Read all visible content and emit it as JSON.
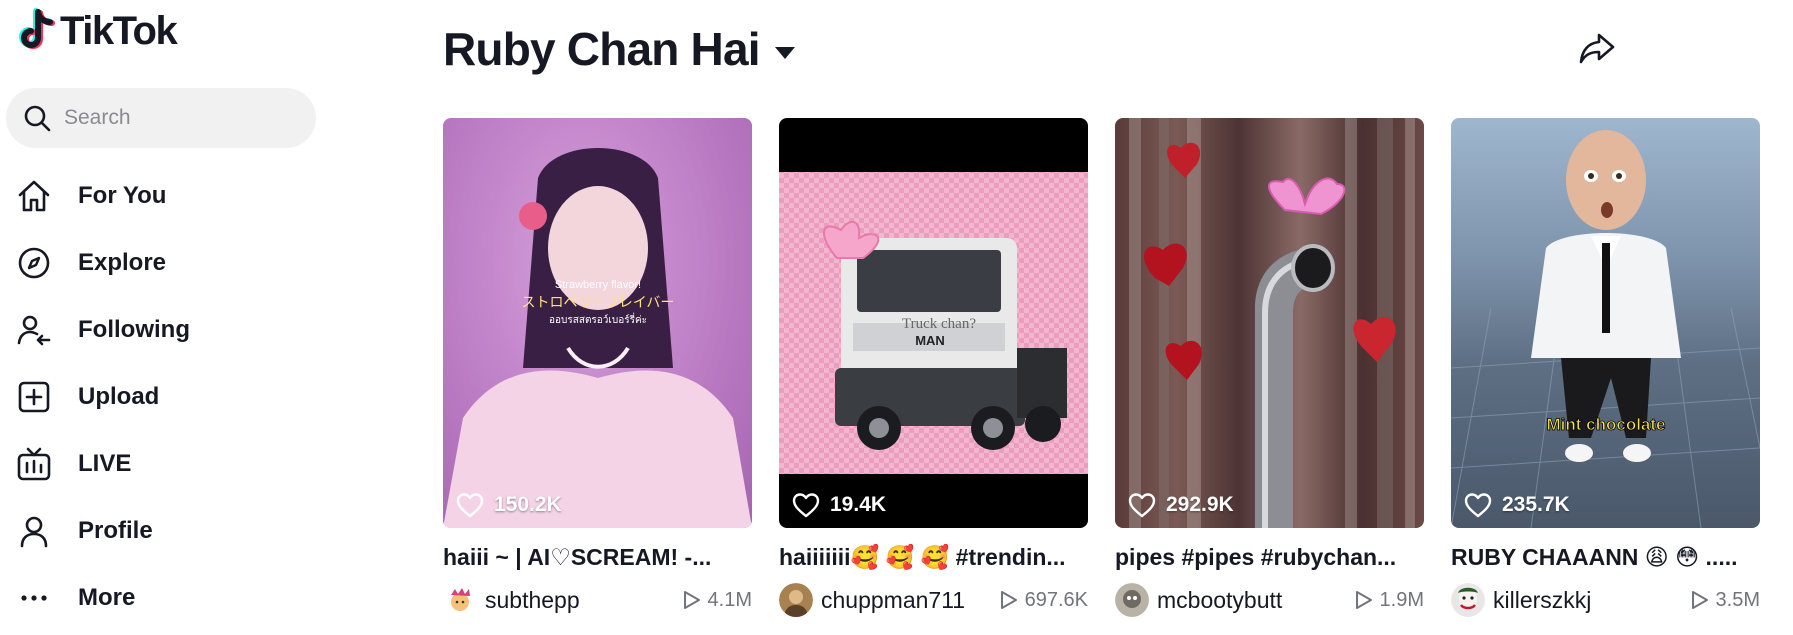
{
  "app": {
    "logo_text": "TikTok"
  },
  "search": {
    "placeholder": "Search"
  },
  "nav": {
    "items": [
      {
        "label": "For You",
        "icon": "home-icon"
      },
      {
        "label": "Explore",
        "icon": "compass-icon"
      },
      {
        "label": "Following",
        "icon": "following-icon"
      },
      {
        "label": "Upload",
        "icon": "upload-icon"
      },
      {
        "label": "LIVE",
        "icon": "live-tv-icon"
      },
      {
        "label": "Profile",
        "icon": "profile-icon"
      },
      {
        "label": "More",
        "icon": "more-dots-icon"
      }
    ]
  },
  "header": {
    "title": "Ruby Chan Hai",
    "share_icon": "share-arrow-icon"
  },
  "videos": [
    {
      "likes": "150.2K",
      "caption": "haiii ~ | AI♡SCREAM! -...",
      "author": "subthepp",
      "views": "4.1M",
      "overlay_lines": [
        "Strawberry flavor!",
        "ストロベリーフレイバー",
        "ออบรสสตรอว์เบอร์รี่ค่ะ"
      ]
    },
    {
      "likes": "19.4K",
      "caption": "haiiiiiii🥰 🥰 🥰 #trendin...",
      "author": "chuppman711",
      "views": "697.6K",
      "overlay_lines": [
        "Truck chan?",
        "MAN"
      ]
    },
    {
      "likes": "292.9K",
      "caption": "pipes #pipes #rubychan...",
      "author": "mcbootybutt",
      "views": "1.9M",
      "overlay_lines": []
    },
    {
      "likes": "235.7K",
      "caption": "RUBY CHAAANN 😩 😳 .....",
      "author": "killerszkkj",
      "views": "3.5M",
      "overlay_lines": [
        "Mint chocolate"
      ]
    }
  ],
  "colors": {
    "brand_cyan": "#25f4ee",
    "brand_red": "#fe2c55",
    "text": "#161823",
    "muted": "#73747b"
  }
}
